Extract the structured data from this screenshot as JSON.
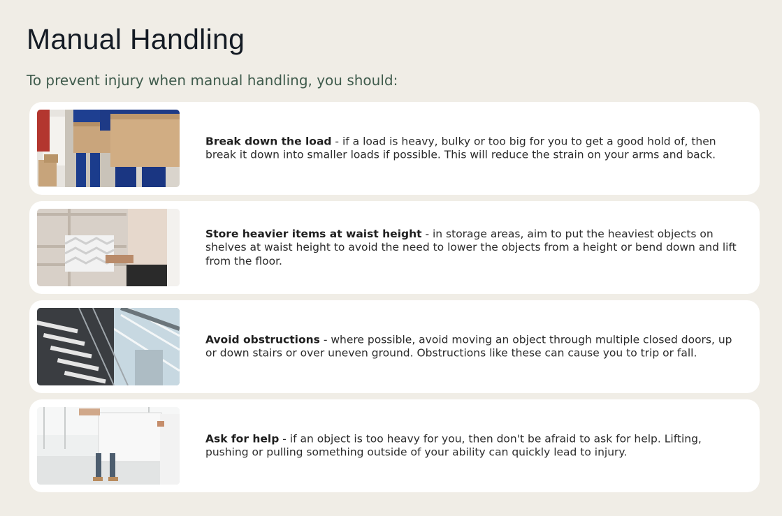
{
  "page": {
    "title": "Manual Handling",
    "subtitle": "To prevent injury when manual handling, you should:"
  },
  "cards": [
    {
      "heading": "Break down the load",
      "body": " - if a load is heavy, bulky or too big for you to get a good hold of, then break it down into smaller loads if possible. This will reduce the strain on your arms and back.",
      "image": "people-carrying-boxes-image"
    },
    {
      "heading": "Store heavier items at waist height",
      "body": " - in storage areas, aim to put the heaviest objects on shelves at waist height to avoid the need to lower the objects from a height or bend down and lift from the floor.",
      "image": "person-placing-box-on-shelf-image"
    },
    {
      "heading": "Avoid obstructions",
      "body": " - where possible, avoid moving an object through multiple closed doors, up or down stairs or over uneven ground. Obstructions like these can cause you to trip or fall.",
      "image": "staircase-image"
    },
    {
      "heading": "Ask for help",
      "body": " - if an object is too heavy for you, then don't be afraid to ask for help. Lifting, pushing or pulling something outside of your ability can quickly lead to injury.",
      "image": "two-people-carrying-board-image"
    }
  ],
  "colors": {
    "background": "#f0ede6",
    "card": "#ffffff",
    "title": "#141b24",
    "subtitle": "#3f5b4c",
    "text": "#2b2b2b"
  }
}
